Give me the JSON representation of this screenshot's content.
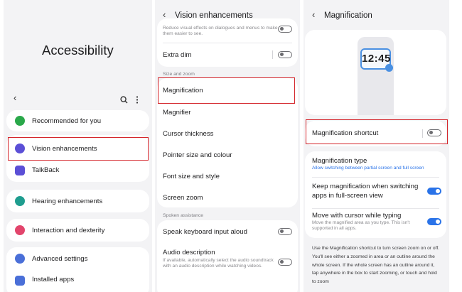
{
  "panel1": {
    "title": "Accessibility",
    "items": [
      {
        "label": "Recommended for you",
        "icon": "recommended-icon",
        "color": "#2aa84a"
      },
      {
        "label": "Vision enhancements",
        "icon": "vision-icon",
        "color": "#5b4fd6"
      },
      {
        "label": "TalkBack",
        "icon": "talkback-icon",
        "color": "#5b4fd6"
      },
      {
        "label": "Hearing enhancements",
        "icon": "hearing-icon",
        "color": "#1f9d8f"
      },
      {
        "label": "Interaction and dexterity",
        "icon": "interaction-icon",
        "color": "#e2456c"
      },
      {
        "label": "Advanced settings",
        "icon": "advanced-icon",
        "color": "#4a6fd8"
      },
      {
        "label": "Installed apps",
        "icon": "apps-icon",
        "color": "#4a6fd8"
      }
    ]
  },
  "panel2": {
    "title": "Vision enhancements",
    "top_cut_text": "Reduce visual effects on dialogues and menus to make them easier to see.",
    "extra_dim": "Extra dim",
    "section_size_zoom": "Size and zoom",
    "items": [
      "Magnification",
      "Magnifier",
      "Cursor thickness",
      "Pointer size and colour",
      "Font size and style",
      "Screen zoom"
    ],
    "section_spoken": "Spoken assistance",
    "speak_keyboard": "Speak keyboard input aloud",
    "audio_description": "Audio description",
    "audio_description_sub": "If available, automatically select the audio soundtrack with an audio description while watching videos."
  },
  "panel3": {
    "title": "Magnification",
    "clock_time": "12:45",
    "shortcut": "Magnification shortcut",
    "type_title": "Magnification type",
    "type_sub": "Allow switching between partial screen and full screen",
    "keep_mag": "Keep magnification when switching apps in full-screen view",
    "move_cursor": "Move with cursor while typing",
    "move_cursor_sub": "Move the magnified area as you type. This isn't supported in all apps.",
    "description": "Use the Magnification shortcut to turn screen zoom on or off. You'll see either a zoomed in area or an outline around the whole screen. If the whole screen has an outline around it, tap anywhere in the box to start zooming, or touch and hold to zoom",
    "accent": "#2a73e8"
  },
  "colors": {
    "highlight": "#d4252b",
    "toggle_on": "#2a73e8"
  }
}
